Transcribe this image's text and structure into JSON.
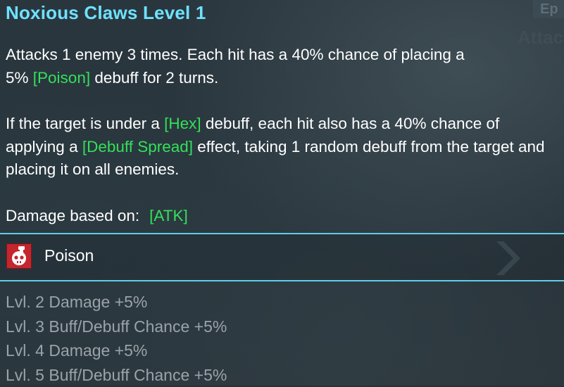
{
  "background_tag": "Ep",
  "background_heading": "Attac",
  "skill": {
    "title": "Noxious Claws Level 1",
    "paragraph1": {
      "line1": "Attacks 1 enemy 3 times. Each hit has a 40% chance of placing a",
      "prefix": "5% ",
      "keyword": "[Poison]",
      "suffix": " debuff for 2 turns."
    },
    "paragraph2": {
      "part1": "If the target is under a ",
      "keyword1": "[Hex]",
      "part2": " debuff, each hit also has a 40% chance of applying a ",
      "keyword2": "[Debuff Spread]",
      "part3": " effect, taking 1 random debuff from the target and placing it on all enemies."
    },
    "damage_based_on": {
      "label": "Damage based on:",
      "value": "[ATK]"
    }
  },
  "effect": {
    "label": "Poison",
    "icon": "poison-skull-flask-icon",
    "icon_color": "#c4262e"
  },
  "upgrades": [
    "Lvl. 2 Damage +5%",
    "Lvl. 3 Buff/Debuff Chance +5%",
    "Lvl. 4 Damage +5%",
    "Lvl. 5 Buff/Debuff Chance +5%"
  ],
  "colors": {
    "title": "#6ee2ff",
    "keyword": "#33e05a",
    "separator": "#5fcdea",
    "upgrade_text": "#9aa3a8"
  }
}
